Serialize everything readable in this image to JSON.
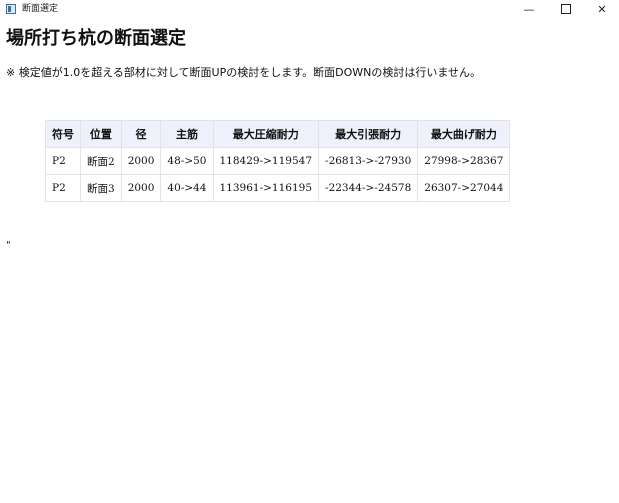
{
  "window": {
    "title": "断面選定",
    "minimize_glyph": "—",
    "close_glyph": "✕"
  },
  "page": {
    "heading": "場所打ち杭の断面選定",
    "note": "※ 検定値が1.0を超える部材に対して断面UPの検討をします。断面DOWNの検討は行いません。",
    "stray_text": "\""
  },
  "table": {
    "headers": [
      "符号",
      "位置",
      "径",
      "主筋",
      "最大圧縮耐力",
      "最大引張耐力",
      "最大曲げ耐力"
    ],
    "rows": [
      [
        "P2",
        "断面2",
        "2000",
        "48->50",
        "118429->119547",
        "-26813->-27930",
        "27998->28367"
      ],
      [
        "P2",
        "断面3",
        "2000",
        "40->44",
        "113961->116195",
        "-22344->-24578",
        "26307->27044"
      ]
    ]
  }
}
